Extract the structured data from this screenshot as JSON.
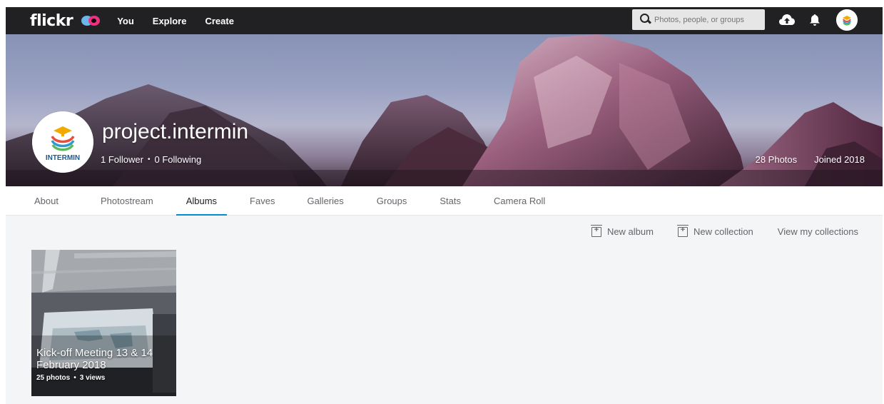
{
  "topnav": {
    "logo": "flickr",
    "links": [
      "You",
      "Explore",
      "Create"
    ],
    "search_placeholder": "Photos, people, or groups",
    "icons": [
      "search-icon",
      "upload-icon",
      "bell-icon",
      "avatar"
    ]
  },
  "profile": {
    "name": "project.intermin",
    "avatar_text": "INTERMIN",
    "followers": "1 Follower",
    "following": "0 Following",
    "separator": "•",
    "photos": "28 Photos",
    "joined": "Joined 2018"
  },
  "subnav": {
    "tabs": [
      "About",
      "Photostream",
      "Albums",
      "Faves",
      "Galleries",
      "Groups",
      "Stats",
      "Camera Roll"
    ],
    "active": "Albums"
  },
  "actions": {
    "new_album": "New album",
    "new_collection": "New collection",
    "view_collections": "View my collections"
  },
  "albums": [
    {
      "title": "Kick-off Meeting 13 & 14 February 2018",
      "photos": "25 photos",
      "separator": "•",
      "views": "3 views"
    }
  ],
  "colors": {
    "topbar": "#212124",
    "accent": "#008ecf",
    "content_bg": "#f3f5f6",
    "flickr_blue": "#6bb7ec",
    "flickr_pink": "#f0307e"
  }
}
